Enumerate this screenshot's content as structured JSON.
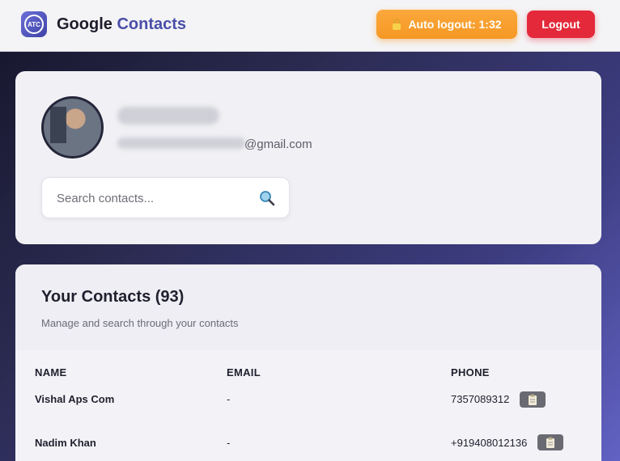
{
  "header": {
    "logo_text": "ATC",
    "brand_first": "Google",
    "brand_second": "Contacts",
    "timer_label": "Auto logout: 1:32",
    "logout_label": "Logout"
  },
  "profile": {
    "email_suffix": "@gmail.com",
    "search_placeholder": "Search contacts..."
  },
  "contacts": {
    "title": "Your Contacts (93)",
    "subtitle": "Manage and search through your contacts",
    "columns": [
      "NAME",
      "EMAIL",
      "PHONE"
    ],
    "rows": [
      {
        "name": "Vishal Aps Com",
        "email": "-",
        "phone": "7357089312"
      },
      {
        "name": "Nadim Khan",
        "email": "-",
        "phone": "+919408012136"
      }
    ]
  }
}
